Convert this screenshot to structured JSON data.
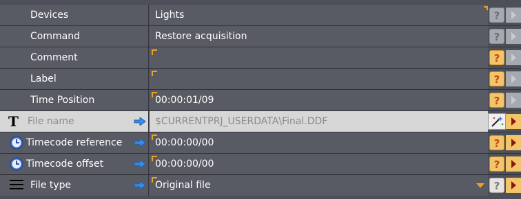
{
  "rows": [
    {
      "label": "Devices",
      "value": "Lights"
    },
    {
      "label": "Command",
      "value": "Restore acquisition"
    },
    {
      "label": "Comment",
      "value": ""
    },
    {
      "label": "Label",
      "value": ""
    },
    {
      "label": "Time Position",
      "value": "00:00:01/09"
    },
    {
      "label": "File name",
      "value": "$CURRENTPRJ_USERDATA\\Final.DDF"
    },
    {
      "label": "Timecode reference",
      "value": "00:00:00/00"
    },
    {
      "label": "Timecode offset",
      "value": "00:00:00/00"
    },
    {
      "label": "File type",
      "value": "Original file"
    }
  ],
  "help_glyph": "?",
  "colors": {
    "background": "#4e5059",
    "cell": "#595b64",
    "accent_orange": "#f0a020",
    "selected_row": "#d7d7d7",
    "link_arrow": "#3a8de8"
  },
  "icons": {
    "file_name": "text-T-icon",
    "timecode": "clock-icon",
    "file_type": "list-icon",
    "link": "right-arrow-icon",
    "browse": "magic-wand-icon"
  }
}
